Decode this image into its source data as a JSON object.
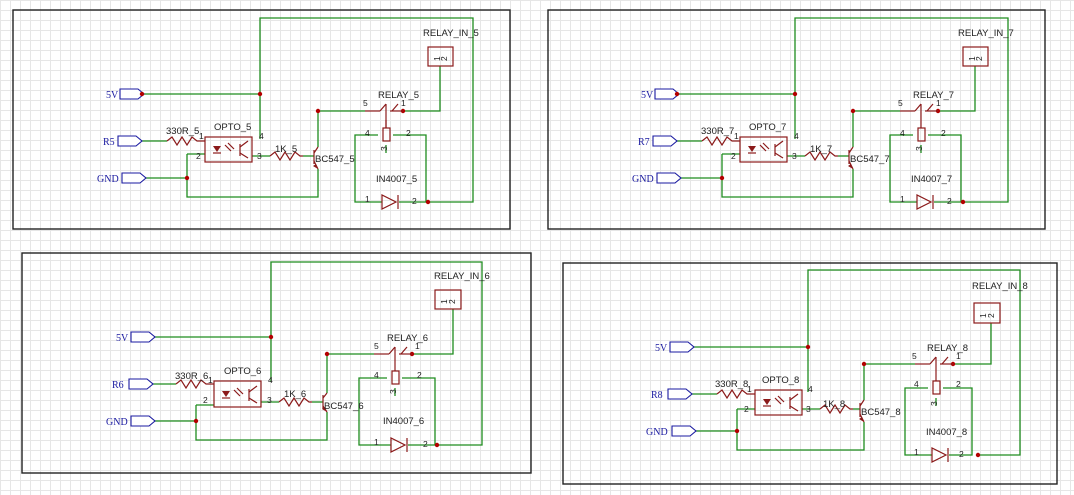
{
  "blocks": [
    {
      "net_5v": "5V",
      "net_in": "R5",
      "net_gnd": "GND",
      "resistor_in": "330R_5",
      "opto": "OPTO_5",
      "resistor_base": "1K_5",
      "transistor": "BC547_5",
      "relay": "RELAY_5",
      "diode": "IN4007_5",
      "connector": "RELAY_IN_5"
    },
    {
      "net_5v": "5V",
      "net_in": "R7",
      "net_gnd": "GND",
      "resistor_in": "330R_7",
      "opto": "OPTO_7",
      "resistor_base": "1K_7",
      "transistor": "BC547_7",
      "relay": "RELAY_7",
      "diode": "IN4007_7",
      "connector": "RELAY_IN_7"
    },
    {
      "net_5v": "5V",
      "net_in": "R6",
      "net_gnd": "GND",
      "resistor_in": "330R_6",
      "opto": "OPTO_6",
      "resistor_base": "1K_6",
      "transistor": "BC547_6",
      "relay": "RELAY_6",
      "diode": "IN4007_6",
      "connector": "RELAY_IN_6"
    },
    {
      "net_5v": "5V",
      "net_in": "R8",
      "net_gnd": "GND",
      "resistor_in": "330R_8",
      "opto": "OPTO_8",
      "resistor_base": "1K_8",
      "transistor": "BC547_8",
      "relay": "RELAY_8",
      "diode": "IN4007_8",
      "connector": "RELAY_IN_8"
    }
  ],
  "pin_numbers": {
    "opto_1": "1",
    "opto_2": "2",
    "opto_3": "3",
    "opto_4": "4",
    "relay_1": "1",
    "relay_2": "2",
    "relay_3": "3",
    "relay_4": "4",
    "relay_5": "5",
    "diode_1": "1",
    "diode_2": "2",
    "conn_1": "1",
    "conn_2": "2"
  }
}
